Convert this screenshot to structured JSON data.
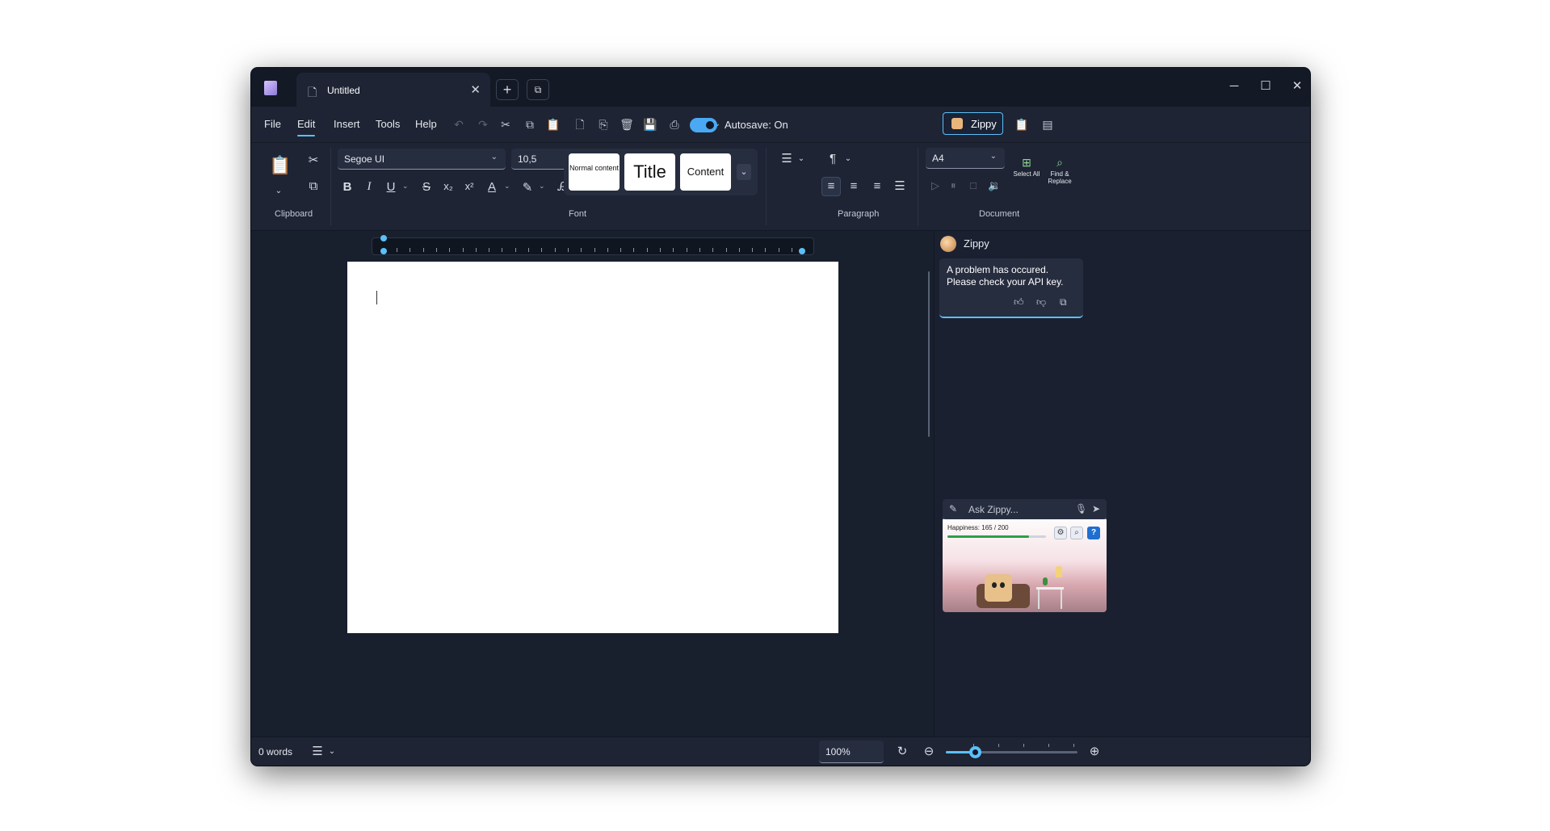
{
  "window": {
    "tab_title": "Untitled",
    "new_tab": "+",
    "minimize": "─",
    "maximize": "☐",
    "close": "✕"
  },
  "menu": {
    "items": [
      "File",
      "Edit",
      "Insert",
      "Tools",
      "Help"
    ],
    "active_index": 1,
    "autosave_label": "Autosave: On",
    "autosave_on": true,
    "zippy_button": "Zippy"
  },
  "ribbon": {
    "clipboard_label": "Clipboard",
    "font_label": "Font",
    "paragraph_label": "Paragraph",
    "document_label": "Document",
    "font_family": "Segoe UI",
    "font_size": "10,5",
    "styles": [
      "Normal content",
      "Title",
      "Content"
    ],
    "page_size": "A4",
    "select_all": "Select All",
    "find_replace": "Find & Replace"
  },
  "sidebar": {
    "assistant_name": "Zippy",
    "message": "A problem has occured. Please check your API key.",
    "ask_placeholder": "Ask Zippy...",
    "happiness_label": "Happiness: 165 / 200",
    "happiness_fraction": 0.825
  },
  "status": {
    "word_count": "0 words",
    "zoom": "100%",
    "zoom_fraction": 0.22
  },
  "colors": {
    "accent": "#5bc0f8",
    "background": "#1a2030"
  }
}
